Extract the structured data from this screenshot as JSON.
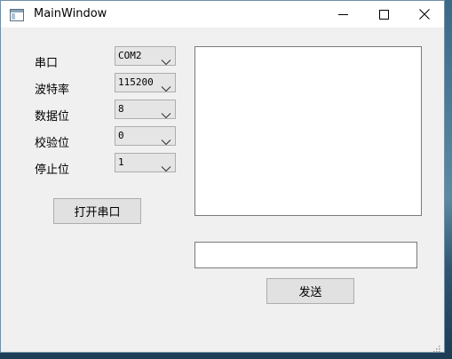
{
  "window": {
    "title": "MainWindow"
  },
  "titlebar": {
    "icons": [
      "app-window-icon",
      "minimize-icon",
      "maximize-icon",
      "close-icon"
    ]
  },
  "settings": {
    "port_label": "串口",
    "port_value": "COM2",
    "baud_label": "波特率",
    "baud_value": "115200",
    "databits_label": "数据位",
    "databits_value": "8",
    "parity_label": "校验位",
    "parity_value": "0",
    "stopbits_label": "停止位",
    "stopbits_value": "1"
  },
  "actions": {
    "open_port_label": "打开串口",
    "send_label": "发送"
  },
  "receive": {
    "text": ""
  },
  "send_input": {
    "value": ""
  },
  "colors": {
    "window_bg": "#f0f0f0",
    "titlebar_bg": "#ffffff",
    "button_bg": "#e1e1e1",
    "border": "#adadad"
  }
}
